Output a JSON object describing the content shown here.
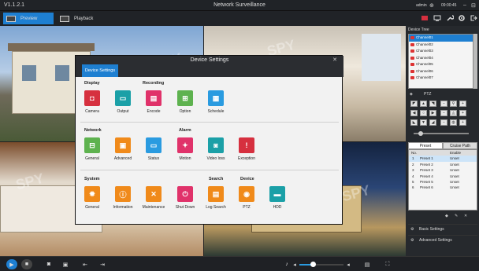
{
  "app": {
    "version": "V1.1.2.1",
    "title": "Network Surveillance",
    "user": "admin",
    "time": "09:00:45"
  },
  "tabs": [
    {
      "label": "Preview"
    },
    {
      "label": "Playback"
    }
  ],
  "watermark": "SPY",
  "dialog": {
    "title": "Device Settings",
    "tab": "Device Settings",
    "sections": {
      "display": "Display",
      "recording": "Recording",
      "network": "Network",
      "alarm": "Alarm",
      "system": "System",
      "search": "Search",
      "device": "Device"
    },
    "items": [
      {
        "label": "Camera",
        "icon": "camera-icon"
      },
      {
        "label": "Output",
        "icon": "monitor-icon"
      },
      {
        "label": "Encode",
        "icon": "encode-icon"
      },
      {
        "label": "Option",
        "icon": "grid-icon"
      },
      {
        "label": "Schedule",
        "icon": "calendar-icon"
      },
      {
        "label": "General",
        "icon": "network-icon"
      },
      {
        "label": "Advanced",
        "icon": "advanced-network-icon"
      },
      {
        "label": "Status",
        "icon": "status-icon"
      },
      {
        "label": "Motion",
        "icon": "running-man-icon"
      },
      {
        "label": "Video loss",
        "icon": "video-loss-icon"
      },
      {
        "label": "Exception",
        "icon": "warning-icon"
      },
      {
        "label": "General",
        "icon": "gear-icon"
      },
      {
        "label": "Information",
        "icon": "info-icon"
      },
      {
        "label": "Maintenance",
        "icon": "tools-icon"
      },
      {
        "label": "Shut Down",
        "icon": "power-icon"
      },
      {
        "label": "Log Search",
        "icon": "log-icon"
      },
      {
        "label": "PTZ",
        "icon": "ptz-icon"
      },
      {
        "label": "HDD",
        "icon": "hdd-icon"
      }
    ]
  },
  "panel": {
    "device_tree": "Device Tree",
    "channels": [
      "Channel01",
      "Channel02",
      "Channel03",
      "Channel04",
      "Channel05",
      "Channel06",
      "Channel07"
    ],
    "ptz": "PTZ",
    "preset_tabs": [
      "Preset",
      "Cruise Path"
    ],
    "preset_headers": {
      "no": "No.",
      "enable": "Enable"
    },
    "presets": [
      {
        "no": "1",
        "name": "Preset 1",
        "state": "Unset"
      },
      {
        "no": "2",
        "name": "Preset 2",
        "state": "Unset"
      },
      {
        "no": "3",
        "name": "Preset 3",
        "state": "Unset"
      },
      {
        "no": "4",
        "name": "Preset 4",
        "state": "Unset"
      },
      {
        "no": "5",
        "name": "Preset 5",
        "state": "Unset"
      },
      {
        "no": "6",
        "name": "Preset 6",
        "state": "Unset"
      }
    ],
    "basic_settings": "Basic Settings",
    "advanced_settings": "Advanced Settings"
  },
  "volume": 0.3,
  "colors": {
    "accent": "#1e7fd1",
    "red": "#d6303f",
    "teal": "#1ba0a7",
    "green": "#5eb24f",
    "orange": "#f08a1a"
  }
}
